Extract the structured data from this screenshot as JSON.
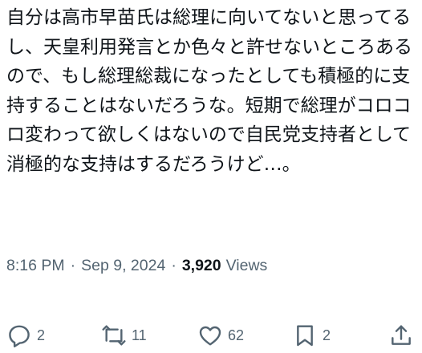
{
  "tweet": {
    "text": "自分は高市早苗氏は総理に向いてないと思ってるし、天皇利用発言とか色々と許せないところあるので、もし総理総裁になったとしても積極的に支持することはないだろうな。短期で総理がコロコロ変わって欲しくはないので自民党支持者として消極的な支持はするだろうけど…。"
  },
  "meta": {
    "time": "8:16 PM",
    "date": "Sep 9, 2024",
    "separator": "·",
    "views_count": "3,920",
    "views_label": "Views"
  },
  "actions": {
    "reply": {
      "icon": "reply-icon",
      "count": "2"
    },
    "repost": {
      "icon": "repost-icon",
      "count": "11"
    },
    "like": {
      "icon": "heart-icon",
      "count": "62"
    },
    "bookmark": {
      "icon": "bookmark-icon",
      "count": "2"
    },
    "share": {
      "icon": "share-icon"
    }
  },
  "colors": {
    "text": "#0f1419",
    "secondary": "#536471",
    "background": "#ffffff"
  }
}
